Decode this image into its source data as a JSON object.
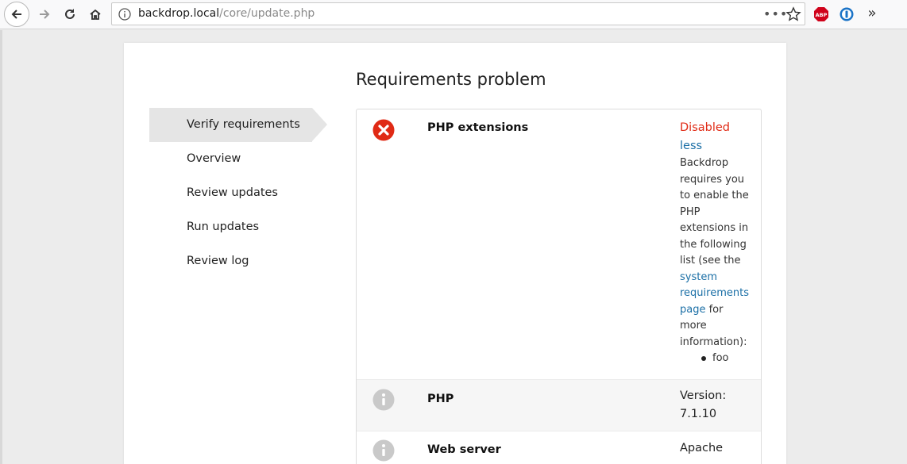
{
  "browser": {
    "url_host": "backdrop.local",
    "url_path": "/core/update.php",
    "url_more": "•••",
    "extension_abp_label": "ABP",
    "overflow_label": "»"
  },
  "page": {
    "title": "Requirements problem"
  },
  "tasks": [
    {
      "label": "Verify requirements",
      "active": true
    },
    {
      "label": "Overview",
      "active": false
    },
    {
      "label": "Review updates",
      "active": false
    },
    {
      "label": "Run updates",
      "active": false
    },
    {
      "label": "Review log",
      "active": false
    }
  ],
  "requirements": [
    {
      "title": "PHP extensions",
      "status": "Disabled",
      "toggle": "less",
      "severity_icon": "error-icon",
      "description_lines": [
        "Backdrop",
        "requires you",
        "to enable the",
        "PHP",
        "extensions in",
        "the following",
        "list (see the"
      ],
      "link_lines": [
        "system",
        "requirements",
        "page"
      ],
      "after_link": " for",
      "tail_lines": [
        "more",
        "information):"
      ],
      "extensions": [
        "foo"
      ]
    },
    {
      "title": "PHP",
      "status_line1": "Version:",
      "status_line2": "7.1.10",
      "severity_icon": "info-icon"
    },
    {
      "title": "Web server",
      "status_line1": "Apache",
      "severity_icon": "info-icon"
    }
  ],
  "colors": {
    "error": "#e02a15",
    "link": "#1b6fa6",
    "active_task_bg": "#e5e5e5"
  }
}
